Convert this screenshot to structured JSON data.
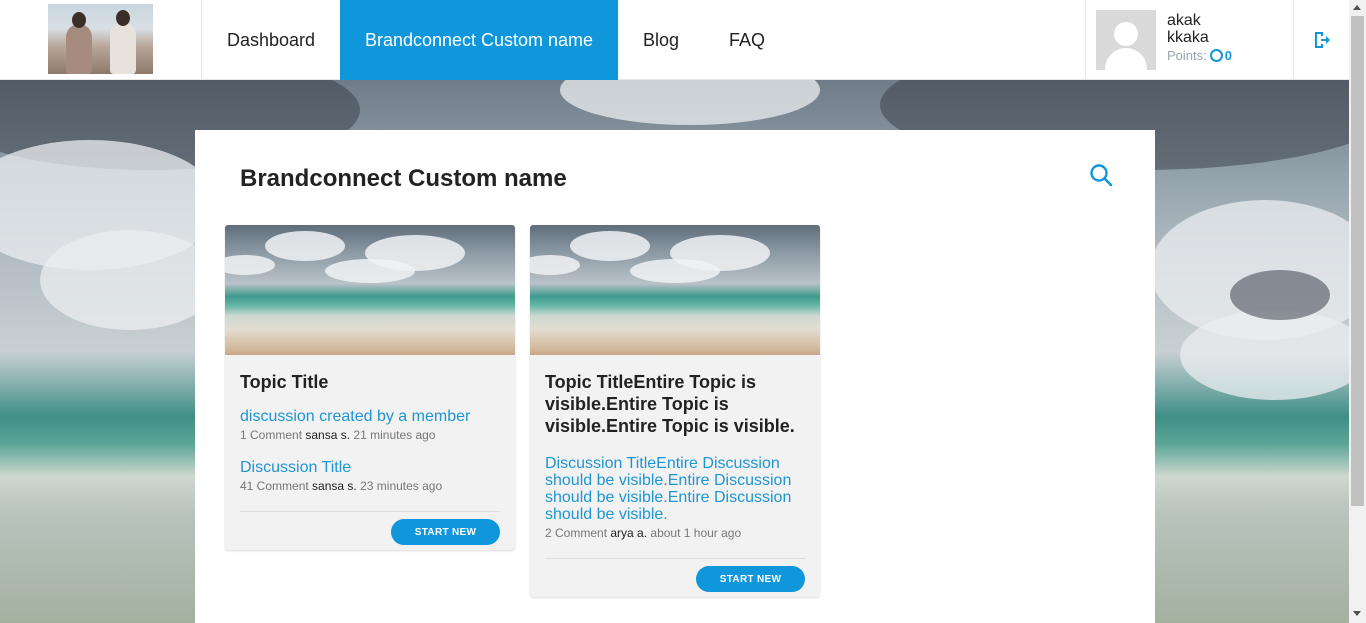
{
  "nav": {
    "items": [
      {
        "label": "Dashboard"
      },
      {
        "label": "Brandconnect Custom name",
        "active": true
      },
      {
        "label": "Blog"
      },
      {
        "label": "FAQ"
      }
    ]
  },
  "user": {
    "first_name": "akak",
    "last_name": "kkaka",
    "points_label": "Points:",
    "points_value": "0"
  },
  "icons": {
    "logout": "logout-icon",
    "search": "search-icon",
    "points": "points-ring-icon",
    "avatar": "default-avatar-icon"
  },
  "colors": {
    "accent": "#0f96db",
    "link": "#1e96d3",
    "card_bg": "#f2f2f2"
  },
  "main": {
    "title": "Brandconnect Custom name",
    "cards": [
      {
        "topic_title": "Topic Title",
        "discussions": [
          {
            "title": "discussion created by a member",
            "comments": "1 Comment",
            "author": "sansa s.",
            "time": "21 minutes ago"
          },
          {
            "title": "Discussion Title",
            "comments": "41 Comment",
            "author": "sansa s.",
            "time": "23 minutes ago"
          }
        ],
        "button_label": "START NEW"
      },
      {
        "topic_title": "Topic TitleEntire Topic is visible.Entire Topic is visible.Entire Topic is visible.",
        "discussions": [
          {
            "title": "Discussion TitleEntire Discussion should be visible.Entire Discussion should be visible.Entire Discussion should be visible.",
            "comments": "2 Comment",
            "author": "arya a.",
            "time": "about 1 hour ago"
          }
        ],
        "button_label": "START NEW"
      }
    ]
  }
}
